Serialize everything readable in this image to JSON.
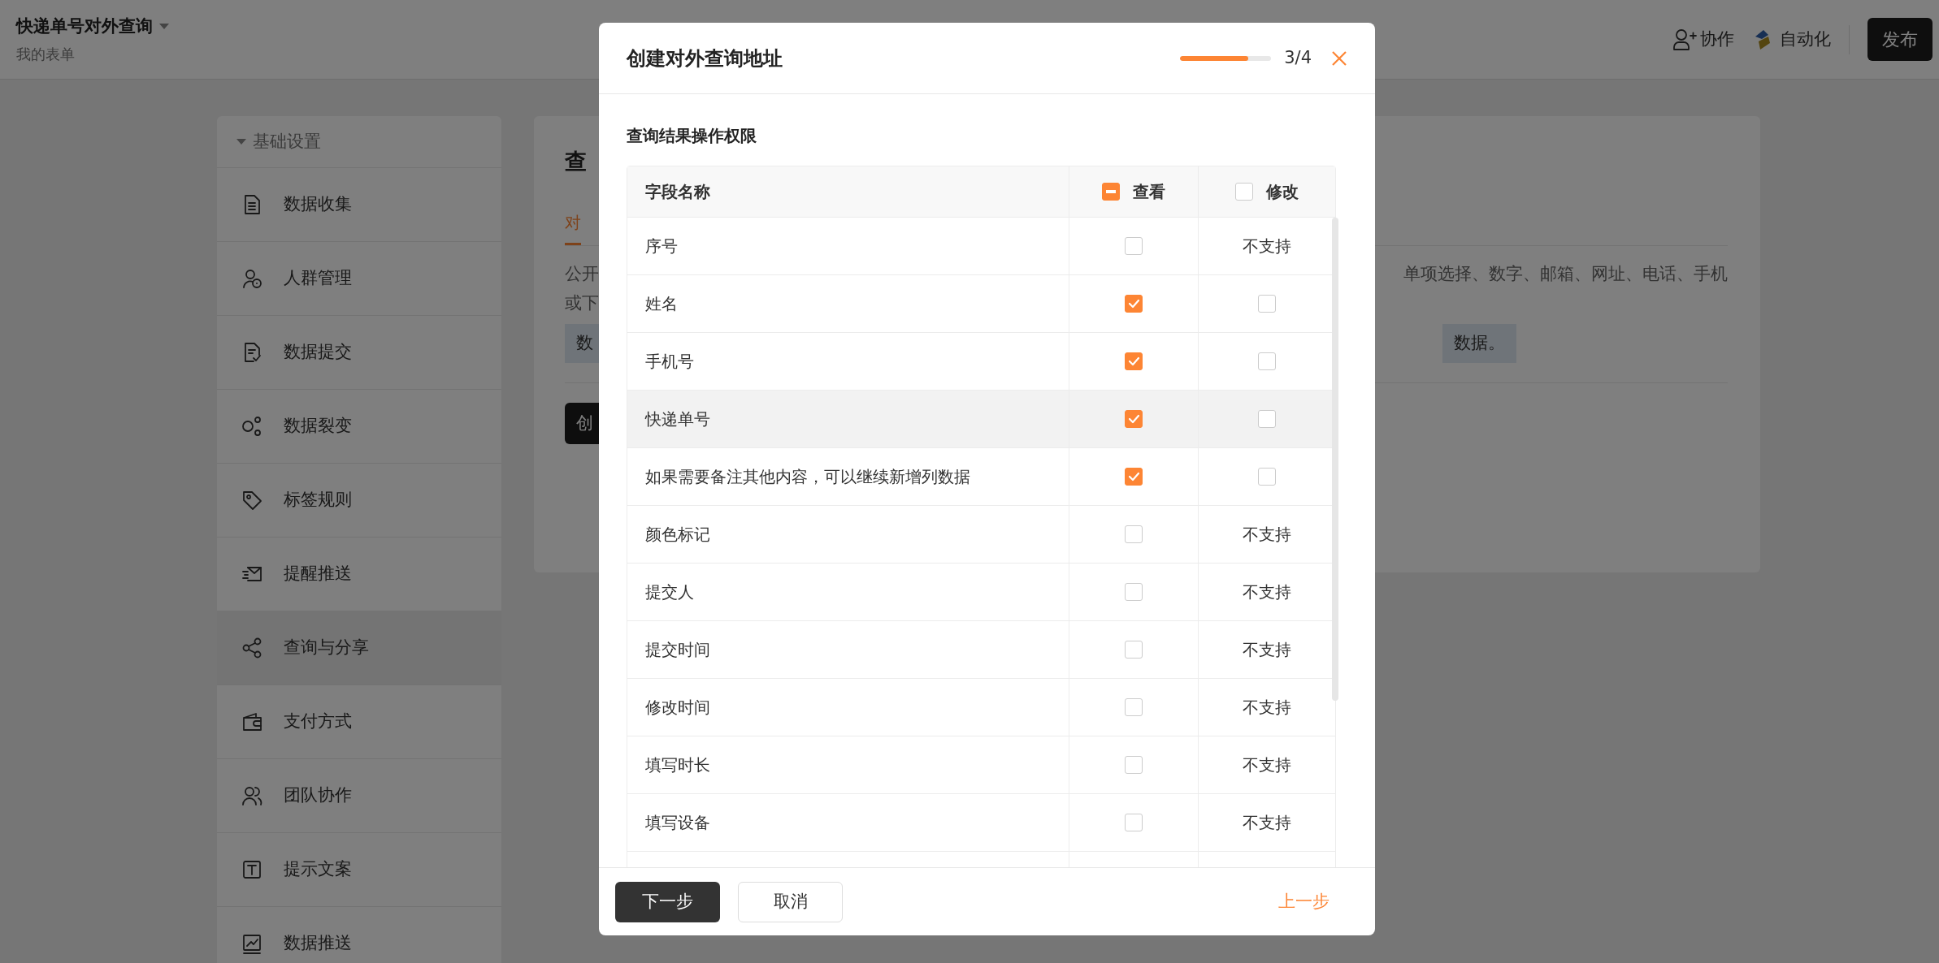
{
  "header": {
    "title": "快递单号对外查询",
    "subtitle": "我的表单",
    "actions": [
      {
        "label": "协作"
      },
      {
        "label": "自动化"
      }
    ],
    "publish": "发布"
  },
  "sidebar": {
    "section": "基础设置",
    "expanded": true,
    "items": [
      {
        "label": "数据收集",
        "selected": false
      },
      {
        "label": "人群管理",
        "selected": false
      },
      {
        "label": "数据提交",
        "selected": false
      },
      {
        "label": "数据裂变",
        "selected": false
      },
      {
        "label": "标签规则",
        "selected": false
      },
      {
        "label": "提醒推送",
        "selected": false
      },
      {
        "label": "查询与分享",
        "selected": true
      },
      {
        "label": "支付方式",
        "selected": false
      },
      {
        "label": "团队协作",
        "selected": false
      },
      {
        "label": "提示文案",
        "selected": false
      },
      {
        "label": "数据推送",
        "selected": false
      }
    ]
  },
  "main": {
    "title": "查",
    "tab": "对",
    "paragraph_left": [
      "公开",
      "或下"
    ],
    "paragraph_right": [
      "单项选择、数字、邮箱、网址、电话、手机"
    ],
    "notice_left": "数",
    "notice_right": "数据。",
    "button": "创"
  },
  "dialog": {
    "title": "创建对外查询地址",
    "progress": {
      "level": 0.75,
      "label": "3/4"
    },
    "section": "查询结果操作权限",
    "columns": [
      {
        "label": "字段名称"
      },
      {
        "label": "查看",
        "indeterminate": true
      },
      {
        "label": "修改",
        "checked": false
      }
    ],
    "rows": [
      {
        "field": "序号",
        "view_checked": false,
        "hovered": false,
        "edit": {
          "kind": "text",
          "text": "不支持"
        }
      },
      {
        "field": "姓名",
        "view_checked": true,
        "hovered": false,
        "edit": {
          "kind": "checkbox",
          "checked": false
        }
      },
      {
        "field": "手机号",
        "view_checked": true,
        "hovered": false,
        "edit": {
          "kind": "checkbox",
          "checked": false
        }
      },
      {
        "field": "快递单号",
        "view_checked": true,
        "hovered": true,
        "edit": {
          "kind": "checkbox",
          "checked": false
        }
      },
      {
        "field": "如果需要备注其他内容，可以继续新增列数据",
        "view_checked": true,
        "hovered": false,
        "edit": {
          "kind": "checkbox",
          "checked": false
        }
      },
      {
        "field": "颜色标记",
        "view_checked": false,
        "hovered": false,
        "edit": {
          "kind": "text",
          "text": "不支持"
        }
      },
      {
        "field": "提交人",
        "view_checked": false,
        "hovered": false,
        "edit": {
          "kind": "text",
          "text": "不支持"
        }
      },
      {
        "field": "提交时间",
        "view_checked": false,
        "hovered": false,
        "edit": {
          "kind": "text",
          "text": "不支持"
        }
      },
      {
        "field": "修改时间",
        "view_checked": false,
        "hovered": false,
        "edit": {
          "kind": "text",
          "text": "不支持"
        }
      },
      {
        "field": "填写时长",
        "view_checked": false,
        "hovered": false,
        "edit": {
          "kind": "text",
          "text": "不支持"
        }
      },
      {
        "field": "填写设备",
        "view_checked": false,
        "hovered": false,
        "edit": {
          "kind": "text",
          "text": "不支持"
        }
      }
    ],
    "buttons": [
      {
        "label": "下一步",
        "kind": "primary"
      },
      {
        "label": "取消",
        "kind": "secondary"
      },
      {
        "label": "上一步",
        "kind": "link"
      }
    ]
  }
}
